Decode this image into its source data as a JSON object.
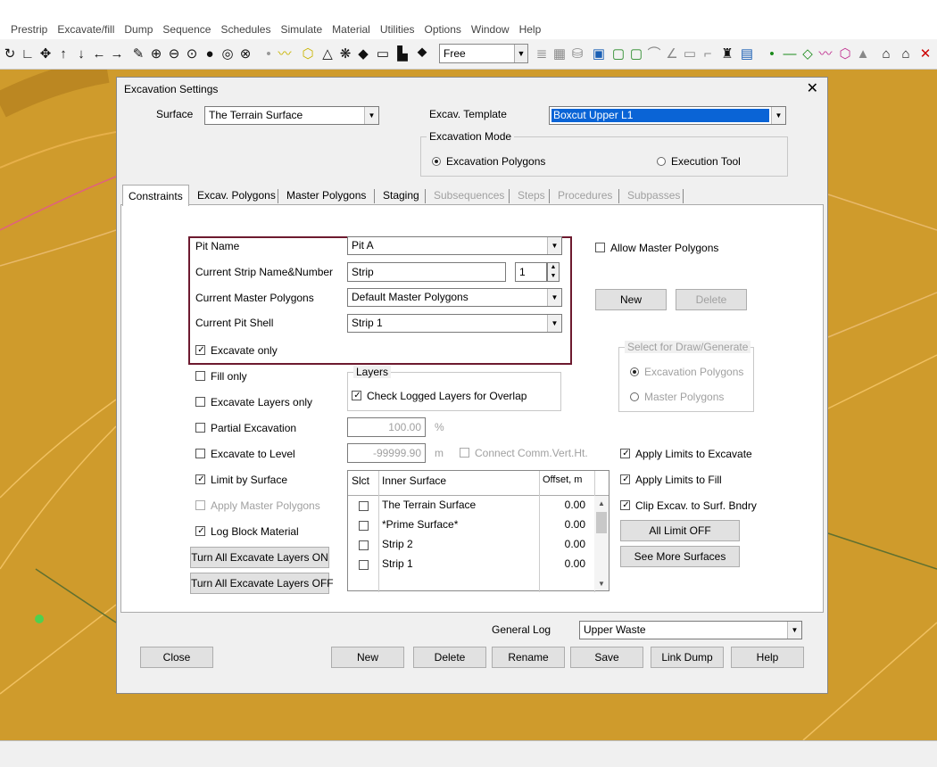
{
  "menu": [
    "Prestrip",
    "Excavate/fill",
    "Dump",
    "Sequence",
    "Schedules",
    "Simulate",
    "Material",
    "Utilities",
    "Options",
    "Window",
    "Help"
  ],
  "toolbar": {
    "view_mode": "Free"
  },
  "dialog": {
    "title": "Excavation Settings",
    "surface_label": "Surface",
    "surface_value": "The Terrain Surface",
    "template_label": "Excav. Template",
    "template_value": "Boxcut Upper L1",
    "mode_group": "Excavation Mode",
    "mode_option1": "Excavation Polygons",
    "mode_option2": "Execution Tool",
    "tabs": [
      "Constraints",
      "Excav. Polygons",
      "Master Polygons",
      "Staging",
      "Subsequences",
      "Steps",
      "Procedures",
      "Subpasses"
    ],
    "pit_name_label": "Pit Name",
    "pit_name_value": "Pit A",
    "strip_label": "Current Strip Name&Number",
    "strip_value": "Strip",
    "strip_number": "1",
    "master_polygons_label": "Current Master Polygons",
    "master_polygons_value": "Default Master Polygons",
    "pit_shell_label": "Current Pit Shell",
    "pit_shell_value": "Strip 1",
    "excavate_only": "Excavate only",
    "allow_master": "Allow Master Polygons",
    "new_btn": "New",
    "delete_btn": "Delete",
    "select_group": "Select for Draw/Generate",
    "select_opt1": "Excavation Polygons",
    "select_opt2": "Master Polygons",
    "fill_only": "Fill only",
    "excavate_layers_only": "Excavate Layers only",
    "partial_excavation": "Partial Excavation",
    "excavate_to_level": "Excavate to Level",
    "limit_by_surface": "Limit by Surface",
    "apply_master_polygons": "Apply Master Polygons",
    "log_block_material": "Log Block Material",
    "layers_group": "Layers",
    "check_logged_layers": "Check Logged Layers for Overlap",
    "partial_value": "100.00",
    "partial_unit": "%",
    "level_value": "-99999.90",
    "level_unit": "m",
    "connect_comm": "Connect Comm.Vert.Ht.",
    "apply_limits_excavate": "Apply Limits to Excavate",
    "apply_limits_fill": "Apply Limits to Fill",
    "clip_excav": "Clip Excav. to Surf. Bndry",
    "all_limit_off": "All Limit OFF",
    "see_more": "See More Surfaces",
    "turn_on": "Turn All Excavate Layers ON",
    "turn_off": "Turn All Excavate Layers OFF",
    "grid_headers": [
      "Slct",
      "Inner Surface",
      "Offset, m"
    ],
    "grid_rows": [
      {
        "name": "The Terrain Surface",
        "offset": "0.00"
      },
      {
        "name": "*Prime Surface*",
        "offset": "0.00"
      },
      {
        "name": "Strip 2",
        "offset": "0.00"
      },
      {
        "name": "Strip 1",
        "offset": "0.00"
      }
    ],
    "general_log_label": "General Log",
    "general_log_value": "Upper Waste",
    "buttons": {
      "close": "Close",
      "new": "New",
      "delete": "Delete",
      "rename": "Rename",
      "save": "Save",
      "link_dump": "Link Dump",
      "help": "Help"
    }
  }
}
